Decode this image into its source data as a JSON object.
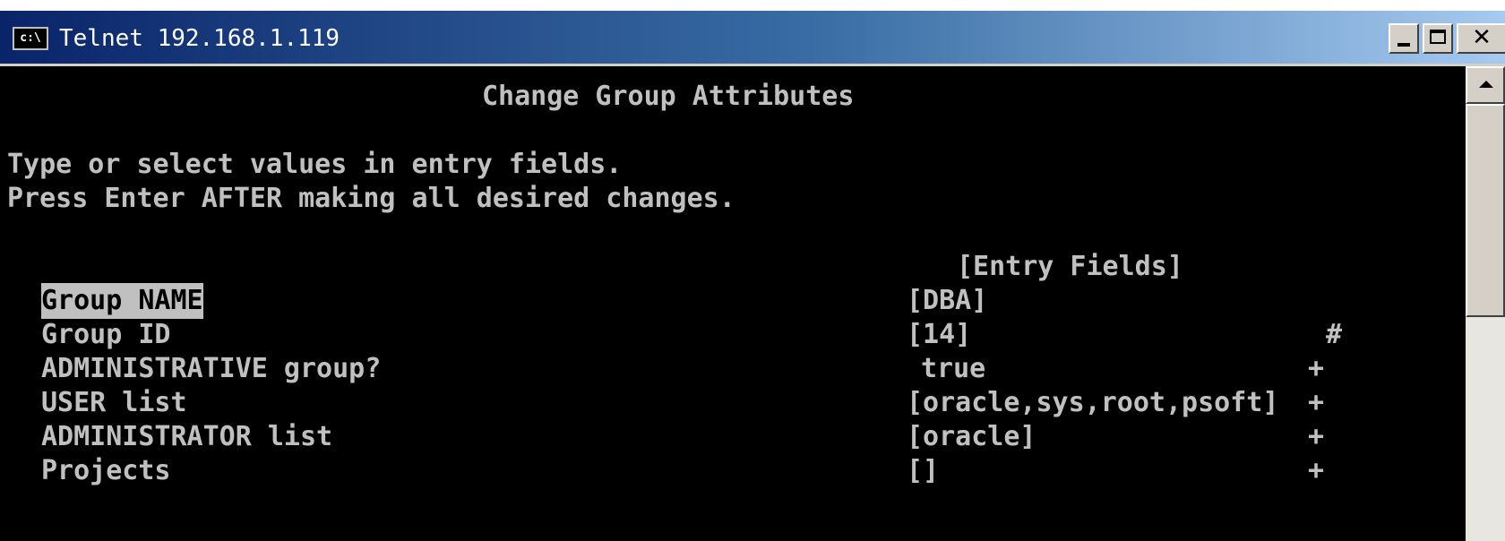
{
  "window": {
    "icon_text": "c:\\",
    "title": "Telnet 192.168.1.119",
    "minimize_label": "_",
    "maximize_label": "□",
    "close_label": "✕"
  },
  "screen": {
    "heading": "Change Group Attributes",
    "instruction_1": "Type or select values in entry fields.",
    "instruction_2": "Press Enter AFTER making all desired changes.",
    "entry_fields_header": "[Entry Fields]",
    "fields": [
      {
        "label": "Group NAME",
        "value": "[DBA]",
        "indicator": ""
      },
      {
        "label": "Group ID",
        "value": "[14]",
        "indicator": "#"
      },
      {
        "label": "ADMINISTRATIVE group?",
        "value": "true",
        "indicator": "+"
      },
      {
        "label": "USER list",
        "value": "[oracle,sys,root,psoft]",
        "indicator": "+"
      },
      {
        "label": "ADMINISTRATOR list",
        "value": "[oracle]",
        "indicator": "+"
      },
      {
        "label": "Projects",
        "value": "[]",
        "indicator": "+"
      }
    ]
  },
  "icons": {
    "app": "console-icon",
    "scroll_up": "up-arrow-icon"
  }
}
